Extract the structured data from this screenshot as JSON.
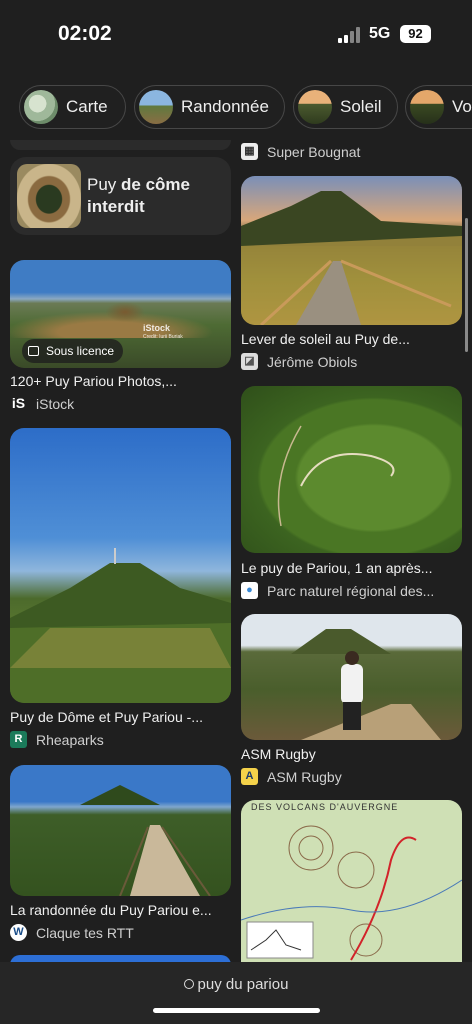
{
  "status": {
    "time": "02:02",
    "network": "5G",
    "battery": "92"
  },
  "chips": [
    {
      "label": "Carte",
      "icon": "map-thumbnail"
    },
    {
      "label": "Randonnée",
      "icon": "hike-thumbnail"
    },
    {
      "label": "Soleil",
      "icon": "sun-thumbnail"
    },
    {
      "label": "Vol",
      "icon": "volcano-thumbnail"
    }
  ],
  "left": {
    "related": {
      "prefix": "Puy ",
      "bold": "de côme interdit"
    },
    "items": [
      {
        "caption": "120+ Puy Pariou Photos,...",
        "source": "iStock",
        "badge": "Sous licence",
        "watermark": "iStock",
        "watermark_credit": "Credit: Iurii Buriak"
      },
      {
        "caption": "Puy de Dôme et Puy Pariou -...",
        "source": "Rheaparks"
      },
      {
        "caption": "La randonnée du Puy Pariou e...",
        "source": "Claque tes RTT"
      }
    ]
  },
  "right": {
    "top_source": "Super Bougnat",
    "items": [
      {
        "caption": "Lever de soleil au Puy de...",
        "source": "Jérôme Obiols"
      },
      {
        "caption": "Le puy de Pariou, 1 an après...",
        "source": "Parc naturel régional des..."
      },
      {
        "caption": "ASM Rugby",
        "source": "ASM Rugby"
      },
      {
        "map_title": "DES VOLCANS D'AUVERGNE"
      }
    ]
  },
  "search": {
    "query": "puy du pariou"
  },
  "colors": {
    "background": "#1f1f1f",
    "chip_border": "#474747",
    "card": "#2b2b2b"
  }
}
